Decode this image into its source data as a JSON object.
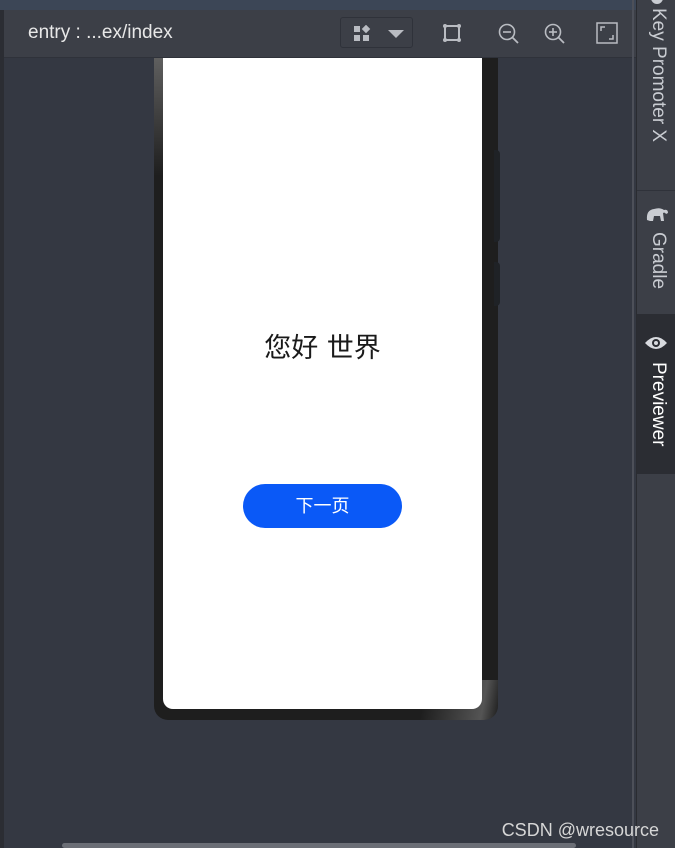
{
  "toolbar": {
    "title": "entry : ...ex/index",
    "icons": {
      "device_layout": "grid-layout-icon",
      "dropdown": "caret-down-icon",
      "bounds": "bounding-box-icon",
      "zoom_out": "zoom-out-icon",
      "zoom_in": "zoom-in-icon",
      "fit": "fit-screen-icon"
    }
  },
  "preview": {
    "hello_text": "您好 世界",
    "next_button_label": "下一页",
    "button_color": "#0a59f7"
  },
  "right_tabs": [
    {
      "label": "Key Promoter X",
      "icon": "key-promoter-icon"
    },
    {
      "label": "Gradle",
      "icon": "elephant-icon"
    },
    {
      "label": "Previewer",
      "icon": "eye-icon",
      "active": true
    }
  ],
  "watermark": "CSDN @wresource"
}
